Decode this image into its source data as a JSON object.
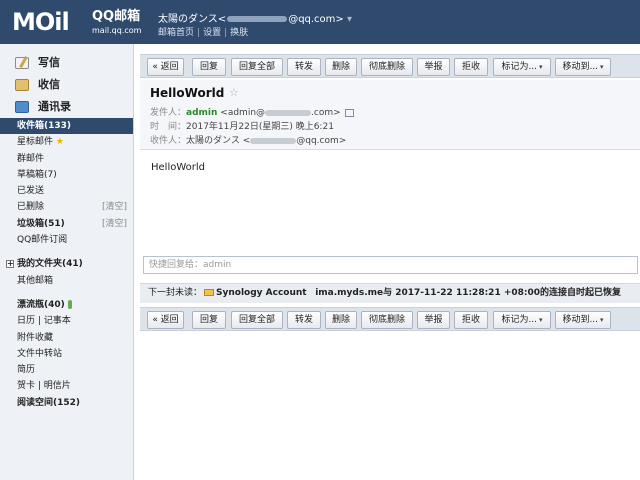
{
  "header": {
    "logo_big": "MOil",
    "logo_qq": "QQ邮箱",
    "logo_url": "mail.qq.com",
    "user_name": "太陽のダンス<",
    "user_email_suffix": "@qq.com>",
    "user_dropdown": "▾",
    "links": [
      "邮箱首页",
      "设置",
      "换肤"
    ]
  },
  "quick": [
    {
      "label": "写信"
    },
    {
      "label": "收信"
    },
    {
      "label": "通讯录"
    }
  ],
  "folders": [
    {
      "label": "收件箱(133)"
    },
    {
      "label": "星标邮件",
      "star": "★"
    },
    {
      "label": "群邮件"
    },
    {
      "label": "草稿箱(7)"
    },
    {
      "label": "已发送"
    },
    {
      "label": "已删除",
      "clear": "[清空]"
    },
    {
      "label": "垃圾箱(51)",
      "clear": "[清空]"
    },
    {
      "label": "QQ邮件订阅"
    },
    {
      "label": "我的文件夹(41)",
      "expand": "+"
    },
    {
      "label": "其他邮箱"
    },
    {
      "label": "漂流瓶(40)"
    },
    {
      "label": "日历 | 记事本"
    },
    {
      "label": "附件收藏"
    },
    {
      "label": "文件中转站"
    },
    {
      "label": "简历"
    },
    {
      "label": "贺卡 | 明信片"
    },
    {
      "label": "阅读空间(152)"
    }
  ],
  "toolbar": {
    "back": "« 返回",
    "reply": "回复",
    "reply_all": "回复全部",
    "forward": "转发",
    "delete": "删除",
    "delete_perm": "彻底删除",
    "report": "举报",
    "reject": "拒收",
    "mark_as": "标记为...",
    "move_to": "移动到...",
    "arrow": "▾"
  },
  "mail": {
    "subject": "HelloWorld",
    "star": "☆",
    "from_label": "发件人：",
    "from_name": "admin",
    "from_email_prefix": "<admin@",
    "from_email_suffix": ".com>",
    "time_label": "时　间：",
    "time_value": "2017年11月22日(星期三) 晚上6:21",
    "to_label": "收件人：",
    "to_name": "太陽のダンス <",
    "to_email_suffix": "@qq.com>",
    "body": "HelloWorld"
  },
  "reply_placeholder": "快捷回复给：admin",
  "next_unread": {
    "label": "下一封未读：",
    "subject": "Synology Account",
    "text": "ima.myds.me与 2017-11-22 11:28:21 +08:00的连接自时起已恢复"
  }
}
